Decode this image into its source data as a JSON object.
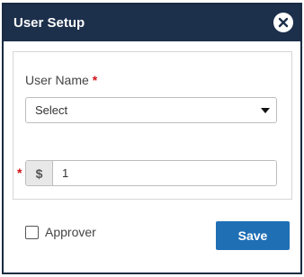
{
  "dialog": {
    "title": "User Setup",
    "close_icon": "close-circle-icon"
  },
  "form": {
    "user_name_label": "User Name",
    "required_mark": "*",
    "user_name_select_value": "Select",
    "amount_prefix": "$",
    "amount_value": "1"
  },
  "footer": {
    "approver_label": "Approver",
    "approver_checked": false,
    "save_label": "Save"
  },
  "colors": {
    "header_bg": "#1c2f4b",
    "accent": "#1f6fb5",
    "required": "#d0141a"
  }
}
